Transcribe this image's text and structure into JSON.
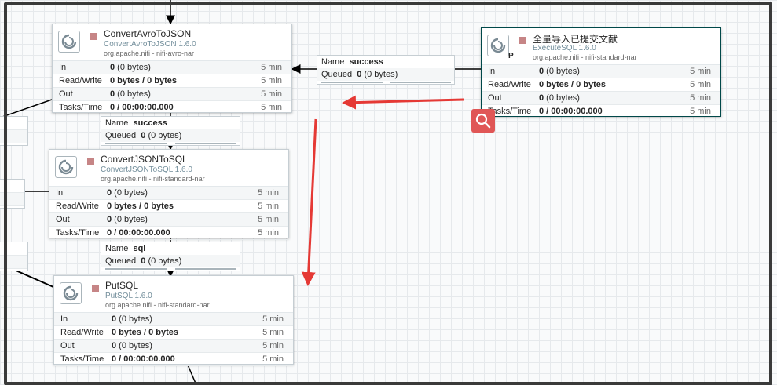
{
  "processors": [
    {
      "id": "convert-avro",
      "name": "ConvertAvroToJSON",
      "type": "ConvertAvroToJSON 1.6.0",
      "bundle": "org.apache.nifi - nifi-avro-nar",
      "stats": [
        {
          "label": "In",
          "value_bold": "0",
          "value_rest": " (0 bytes)",
          "time": "5 min"
        },
        {
          "label": "Read/Write",
          "value_bold": "0 bytes / 0 bytes",
          "value_rest": "",
          "time": "5 min"
        },
        {
          "label": "Out",
          "value_bold": "0",
          "value_rest": " (0 bytes)",
          "time": "5 min"
        },
        {
          "label": "Tasks/Time",
          "value_bold": "0 / 00:00:00.000",
          "value_rest": "",
          "time": "5 min"
        }
      ]
    },
    {
      "id": "convert-json",
      "name": "ConvertJSONToSQL",
      "type": "ConvertJSONToSQL 1.6.0",
      "bundle": "org.apache.nifi - nifi-standard-nar",
      "stats": [
        {
          "label": "In",
          "value_bold": "0",
          "value_rest": " (0 bytes)",
          "time": "5 min"
        },
        {
          "label": "Read/Write",
          "value_bold": "0 bytes / 0 bytes",
          "value_rest": "",
          "time": "5 min"
        },
        {
          "label": "Out",
          "value_bold": "0",
          "value_rest": " (0 bytes)",
          "time": "5 min"
        },
        {
          "label": "Tasks/Time",
          "value_bold": "0 / 00:00:00.000",
          "value_rest": "",
          "time": "5 min"
        }
      ]
    },
    {
      "id": "put-sql",
      "name": "PutSQL",
      "type": "PutSQL 1.6.0",
      "bundle": "org.apache.nifi - nifi-standard-nar",
      "stats": [
        {
          "label": "In",
          "value_bold": "0",
          "value_rest": " (0 bytes)",
          "time": "5 min"
        },
        {
          "label": "Read/Write",
          "value_bold": "0 bytes / 0 bytes",
          "value_rest": "",
          "time": "5 min"
        },
        {
          "label": "Out",
          "value_bold": "0",
          "value_rest": " (0 bytes)",
          "time": "5 min"
        },
        {
          "label": "Tasks/Time",
          "value_bold": "0 / 00:00:00.000",
          "value_rest": "",
          "time": "5 min"
        }
      ]
    },
    {
      "id": "execute-sql",
      "name": "全量导入已提交文献",
      "type": "ExecuteSQL 1.6.0",
      "bundle": "org.apache.nifi - nifi-standard-nar",
      "primary_badge": "P",
      "stats": [
        {
          "label": "In",
          "value_bold": "0",
          "value_rest": " (0 bytes)",
          "time": "5 min"
        },
        {
          "label": "Read/Write",
          "value_bold": "0 bytes / 0 bytes",
          "value_rest": "",
          "time": "5 min"
        },
        {
          "label": "Out",
          "value_bold": "0",
          "value_rest": " (0 bytes)",
          "time": "5 min"
        },
        {
          "label": "Tasks/Time",
          "value_bold": "0 / 00:00:00.000",
          "value_rest": "",
          "time": "5 min"
        }
      ]
    }
  ],
  "connections": [
    {
      "id": "conn-success-exec",
      "name_label": "Name",
      "name": "success",
      "queued_label": "Queued",
      "queued_count": "0",
      "queued_size": " (0 bytes)"
    },
    {
      "id": "conn-success-avro",
      "name_label": "Name",
      "name": "success",
      "queued_label": "Queued",
      "queued_count": "0",
      "queued_size": " (0 bytes)"
    },
    {
      "id": "conn-sql",
      "name_label": "Name",
      "name": "sql",
      "queued_label": "Queued",
      "queued_count": "0",
      "queued_size": " (0 bytes)"
    }
  ],
  "icons": {
    "processor": "processor-icon",
    "stopped": "stopped-icon",
    "search": "search-icon"
  },
  "colors": {
    "stopped": "#c68586",
    "annotation_arrow": "#e53935",
    "search_button": "#e05656",
    "frame": "#3a3a3a"
  }
}
